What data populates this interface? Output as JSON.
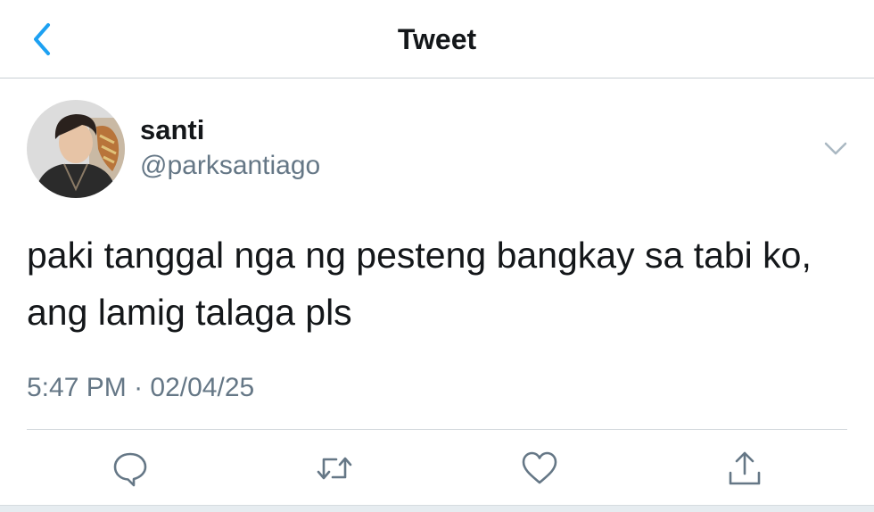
{
  "header": {
    "title": "Tweet",
    "back_icon": "chevron-left-icon"
  },
  "colors": {
    "accent": "#1da1f2",
    "text_primary": "#14171a",
    "text_secondary": "#657786",
    "divider": "#d6dbdf"
  },
  "tweet": {
    "display_name": "santi",
    "handle": "@parksantiago",
    "text": "paki tanggal nga ng pesteng bangkay sa tabi ko, ang lamig talaga pls",
    "time": "5:47 PM",
    "separator": " · ",
    "date": "02/04/25",
    "more_icon": "chevron-down-icon"
  },
  "actions": [
    {
      "name": "reply",
      "icon": "reply-icon"
    },
    {
      "name": "retweet",
      "icon": "retweet-icon"
    },
    {
      "name": "like",
      "icon": "heart-icon"
    },
    {
      "name": "share",
      "icon": "share-icon"
    }
  ]
}
